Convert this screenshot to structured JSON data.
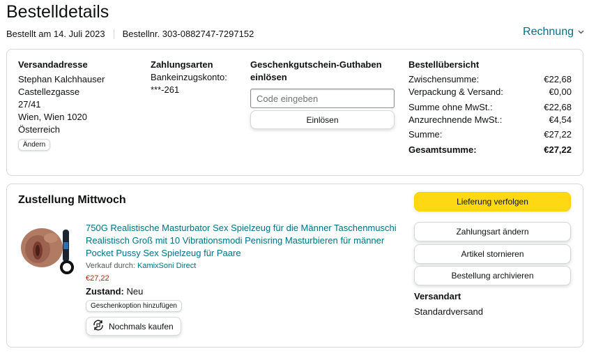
{
  "header": {
    "title": "Bestelldetails",
    "ordered_on": "Bestellt am 14. Juli 2023",
    "order_number": "Bestellnr. 303-0882747-7297152",
    "invoice_label": "Rechnung",
    "invoice_icon": "chevron-down-icon"
  },
  "address": {
    "title": "Versandadresse",
    "lines": [
      "Stephan Kalchhauser",
      "Castellezgasse",
      "27/41",
      "Wien, Wien 1020",
      "Österreich"
    ],
    "change_label": "Ändern"
  },
  "payment": {
    "title": "Zahlungsarten",
    "method": "Bankeinzugskonto:",
    "account": "***-261"
  },
  "gift_card": {
    "title": "Geschenkgutschein-Guthaben einlösen",
    "input_placeholder": "Code eingeben",
    "input_value": "",
    "redeem_label": "Einlösen"
  },
  "summary": {
    "title": "Bestellübersicht",
    "rows": [
      {
        "label": "Zwischensumme:",
        "value": "€22,68"
      },
      {
        "label": "Verpackung & Versand:",
        "value": "€0,00"
      },
      {
        "label": "Summe ohne MwSt.:",
        "value": "€22,68"
      },
      {
        "label": "Anzurechnende MwSt.:",
        "value": "€4,54"
      },
      {
        "label": "Summe:",
        "value": "€27,22"
      },
      {
        "label": "Gesamtsumme:",
        "value": "€27,22"
      }
    ]
  },
  "delivery": {
    "title": "Zustellung Mittwoch",
    "product": {
      "title": "750G Realistische Masturbator Sex Spielzeug für die Männer Taschenmuschi Realistisch Groß mit 10 Vibrationsmodi Penisring Masturbieren für männer Pocket Pussy Sex Spielzeug für Paare",
      "seller_prefix": "Verkauf durch: ",
      "seller_name": "KamixSoni Direct",
      "price": "€27,22",
      "condition_label": "Zustand:",
      "condition_value": "Neu",
      "gift_option_label": "Geschenkoption hinzufügen",
      "buy_again_label": "Nochmals kaufen",
      "buy_again_icon": "reorder-icon"
    },
    "actions": {
      "track": "Lieferung verfolgen",
      "change_payment": "Zahlungsart ändern",
      "cancel": "Artikel stornieren",
      "archive": "Bestellung archivieren"
    },
    "shipping": {
      "title": "Versandart",
      "value": "Standardversand"
    }
  },
  "colors": {
    "link": "#007185",
    "price": "#b12704",
    "primary_button": "#ffd814",
    "border": "#d5d9d9"
  }
}
